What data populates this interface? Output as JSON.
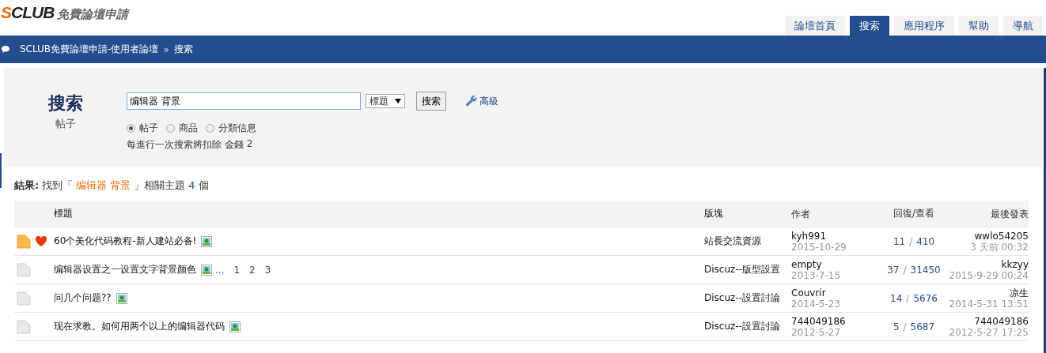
{
  "logo": {
    "brand": "SCLUB",
    "tagline": "免費論壇申請"
  },
  "tabs": [
    {
      "label": "論壇首頁",
      "selected": false
    },
    {
      "label": "搜索",
      "selected": true
    },
    {
      "label": "應用程序",
      "selected": false
    },
    {
      "label": "幫助",
      "selected": false
    },
    {
      "label": "導航",
      "selected": false
    }
  ],
  "breadcrumb": {
    "site": "SCLUB免費論壇申請-使用者論壇",
    "separator": "»",
    "current": "搜索"
  },
  "search": {
    "title": "搜索",
    "subtitle": "帖子",
    "value": "编辑器 背景",
    "scope": "標題",
    "button": "搜索",
    "advanced": "高級",
    "types": [
      {
        "label": "帖子",
        "selected": true
      },
      {
        "label": "商品",
        "selected": false
      },
      {
        "label": "分類信息",
        "selected": false
      }
    ],
    "cost_note": "每進行一次搜索將扣除 金錢",
    "cost": "2"
  },
  "result": {
    "label": "結果:",
    "prefix": "找到「",
    "keyword": "编辑器 背景",
    "suffix": "」相關主題",
    "count": "4",
    "unit": "個"
  },
  "table": {
    "columns": [
      "標題",
      "版塊",
      "作者",
      "回復/查看",
      "最後發表"
    ],
    "rows": [
      {
        "hot": true,
        "favorite": true,
        "title": "60个美化代码教程-新人建站必备!",
        "pages": [],
        "forum": "站長交流資源",
        "author": "kyh991",
        "date": "2015-10-29",
        "replies": "11",
        "separator": "/",
        "views": "410",
        "last_user": "wwlo54205",
        "last_time": "3 天前 00:32"
      },
      {
        "hot": false,
        "favorite": false,
        "title": "编辑器设置之一设置文字背景颜色",
        "pages": [
          "...",
          "1",
          "2",
          "3"
        ],
        "forum": "Discuz--版型設置",
        "author": "empty",
        "date": "2013-7-15",
        "replies": "37",
        "separator": "/",
        "views": "31450",
        "last_user": "kkzyy",
        "last_time": "2015-9-29 00:24"
      },
      {
        "hot": false,
        "favorite": false,
        "title": "问几个问题??",
        "pages": [],
        "forum": "Discuz--設置討論",
        "author": "Couvrir",
        "date": "2014-5-23",
        "replies": "14",
        "separator": "/",
        "views": "5676",
        "last_user": "凉生",
        "last_time": "2014-5-31 13:51"
      },
      {
        "hot": false,
        "favorite": false,
        "title": "现在求教。如何用两个以上的编辑器代码",
        "pages": [],
        "forum": "Discuz--設置討論",
        "author": "744049186",
        "date": "2012-5-27",
        "replies": "5",
        "separator": "/",
        "views": "5687",
        "last_user": "744049186",
        "last_time": "2012-5-27 17:25"
      }
    ]
  }
}
